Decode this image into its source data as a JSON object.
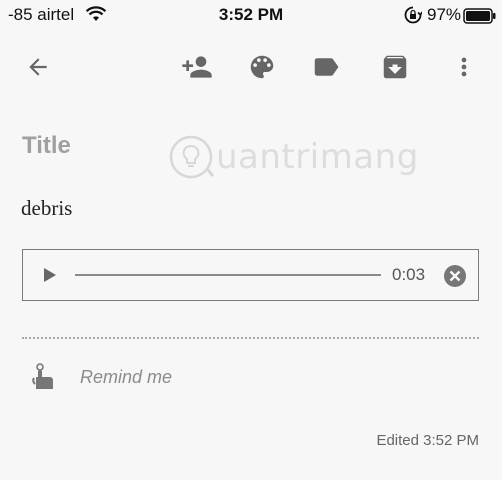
{
  "status_bar": {
    "carrier": "-85 airtel",
    "time": "3:52 PM",
    "battery": "97%"
  },
  "toolbar": {
    "icons": [
      "back-arrow-icon",
      "add-collaborator-icon",
      "palette-icon",
      "label-icon",
      "archive-icon",
      "more-vert-icon"
    ]
  },
  "note": {
    "title_placeholder": "Title",
    "body": "debris",
    "watermark": "uantrimang"
  },
  "audio": {
    "duration": "0:03",
    "progress": 0
  },
  "reminder": {
    "label": "Remind me"
  },
  "footer": {
    "edited": "Edited 3:52 PM"
  },
  "colors": {
    "background": "#f7f7f7",
    "icon": "#666666",
    "border": "#7a7a7a"
  }
}
